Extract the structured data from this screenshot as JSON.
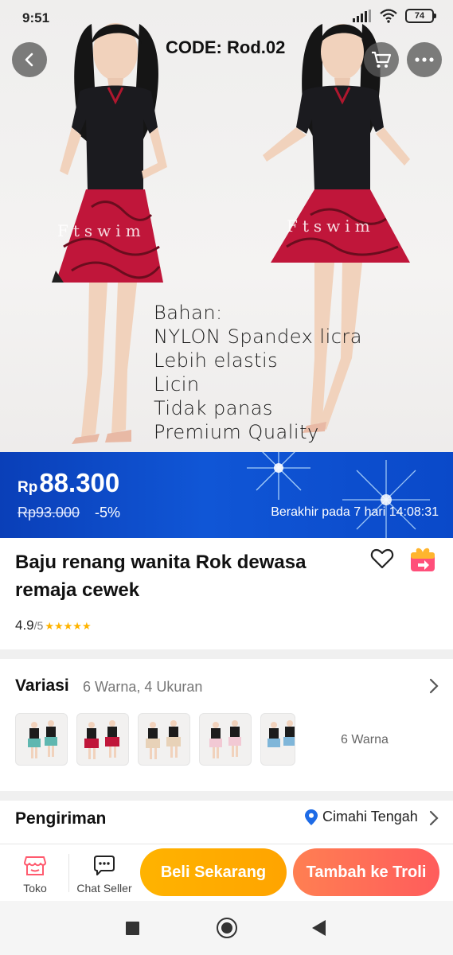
{
  "status_bar": {
    "time": "9:51",
    "battery": "74"
  },
  "hero": {
    "code_label": "CODE: Rod.02",
    "watermark": "Ftswim",
    "overlay_lines": [
      "Bahan:",
      "NYLON Spandex licra",
      "Lebih elastis",
      "Licin",
      "Tidak panas",
      "Premium Quality"
    ]
  },
  "price": {
    "currency": "Rp",
    "current": "88.300",
    "original": "Rp93.000",
    "discount": "-5%",
    "ends": "Berakhir pada 7 hari 14:08:31",
    "accent_color": "#0b47c6"
  },
  "product": {
    "title": "Baju renang wanita Rok dewasa remaja cewek",
    "rating": "4.9",
    "rating_max": "/5",
    "stars": "★★★★★",
    "star_color": "#ffb400"
  },
  "variation": {
    "title": "Variasi",
    "summary": "6 Warna, 4 Ukuran",
    "color_count_label": "6 Warna"
  },
  "shipping": {
    "title": "Pengiriman",
    "location": "Cimahi Tengah"
  },
  "actions": {
    "toko_label": "Toko",
    "chat_label": "Chat Seller",
    "buy_label": "Beli Sekarang",
    "cart_label": "Tambah ke Troli",
    "buy_color": "#ffab00",
    "cart_color": "#ff6a55"
  },
  "icons": {
    "back": "back-arrow-icon",
    "cart": "shopping-cart-icon",
    "more": "more-dots-icon",
    "wishlist": "heart-icon",
    "share": "share-gift-icon",
    "location": "location-pin-icon",
    "store": "store-icon",
    "chat": "chat-icon"
  }
}
